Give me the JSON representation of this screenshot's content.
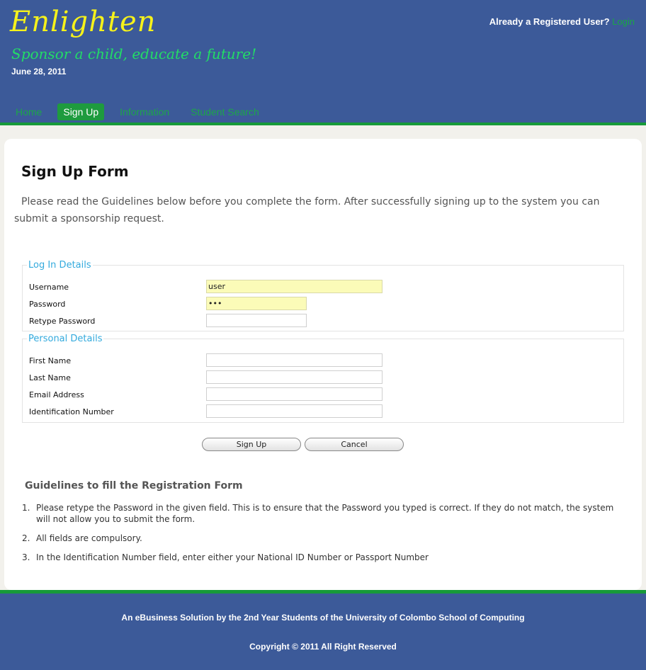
{
  "header": {
    "logo": "Enlighten",
    "tagline": "Sponsor a child, educate a future!",
    "date": "June 28, 2011",
    "registered_prompt": "Already a Registered User?",
    "login_link": "Login"
  },
  "nav": {
    "items": [
      {
        "label": "Home",
        "active": false
      },
      {
        "label": "Sign Up",
        "active": true
      },
      {
        "label": "Information",
        "active": false
      },
      {
        "label": "Student Search",
        "active": false
      }
    ]
  },
  "form": {
    "title": "Sign Up Form",
    "intro": "Please read the Guidelines below before you complete the form. After successfully signing up to the system you can submit a sponsorship request.",
    "login_section": {
      "legend": "Log In Details",
      "username_label": "Username",
      "username_value": "user",
      "password_label": "Password",
      "password_value": "•••",
      "retype_label": "Retype Password",
      "retype_value": ""
    },
    "personal_section": {
      "legend": "Personal Details",
      "first_name_label": "First Name",
      "last_name_label": "Last Name",
      "email_label": "Email Address",
      "id_label": "Identification Number"
    },
    "signup_button": "Sign Up",
    "cancel_button": "Cancel"
  },
  "guidelines": {
    "title": "Guidelines to fill the Registration Form",
    "items": [
      {
        "num": "1.",
        "text": "Please retype the Password in the given field. This is to ensure that the Password you typed is correct. If they do not match, the system will not allow you to submit the form."
      },
      {
        "num": "2.",
        "text": "All fields are compulsory."
      },
      {
        "num": "3.",
        "text": "In the Identification Number field, enter either your National ID Number or Passport Number"
      }
    ]
  },
  "footer": {
    "credit": "An eBusiness Solution by the 2nd Year Students of the University of Colombo School of Computing",
    "copyright": "Copyright © 2011 All Right Reserved"
  },
  "colors": {
    "header_bg": "#3c5a99",
    "accent_green": "#179a3a",
    "logo_yellow": "#f6f21b",
    "tagline_green": "#22dd66",
    "legend_blue": "#33aadd",
    "filled_input_bg": "#fbfbb8"
  }
}
